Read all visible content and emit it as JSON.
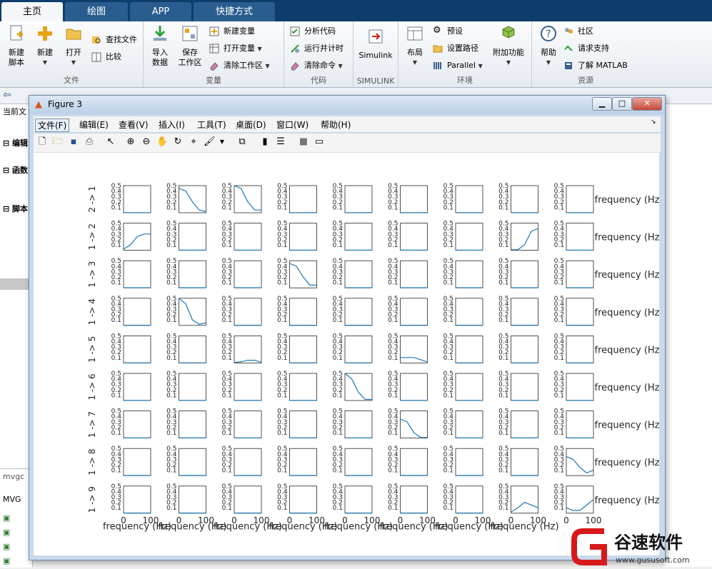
{
  "ribbon": {
    "tabs": [
      "主页",
      "绘图",
      "APP",
      "快捷方式"
    ],
    "groups": {
      "file": {
        "label": "文件",
        "new_script": "新建\n脚本",
        "new": "新建",
        "open": "打开",
        "find_files": "查找文件",
        "compare": "比较"
      },
      "variable": {
        "label": "变量",
        "import": "导入\n数据",
        "save_ws": "保存\n工作区",
        "new_var": "新建变量",
        "open_var": "打开变量",
        "clear_ws": "清除工作区"
      },
      "code": {
        "label": "代码",
        "analyze": "分析代码",
        "run_time": "运行并计时",
        "clear_cmd": "清除命令"
      },
      "simulink": {
        "label": "SIMULINK",
        "simulink": "Simulink"
      },
      "env": {
        "label": "环境",
        "layout": "布局",
        "prefs": "预设",
        "set_path": "设置路径",
        "parallel": "Parallel",
        "addons": "附加功能"
      },
      "resources": {
        "label": "资源",
        "help": "帮助",
        "community": "社区",
        "support": "请求支持",
        "learn": "了解 MATLAB"
      }
    }
  },
  "background": {
    "current_folder": "当前文",
    "editor": "编辑",
    "functions": "函数",
    "scripts": "脚本",
    "bottom_title": "mvgc",
    "bottom_item": "MVG"
  },
  "figure": {
    "title": "Figure 3",
    "menu": [
      "文件(F)",
      "编辑(E)",
      "查看(V)",
      "插入(I)",
      "工具(T)",
      "桌面(D)",
      "窗口(W)",
      "帮助(H)"
    ],
    "xlabel": "frequency (Hz)",
    "tick_x": [
      "0",
      "100"
    ],
    "tick_y": [
      "0.5",
      "0.4",
      "0.3",
      "0.2",
      "0.1"
    ]
  },
  "chart_data": {
    "type": "line",
    "title": "",
    "xlabel": "frequency (Hz)",
    "ylabel": "",
    "grid_size": [
      9,
      9
    ],
    "xlim": [
      0,
      100
    ],
    "ylim": [
      0,
      0.5
    ],
    "yticks": [
      0.1,
      0.2,
      0.3,
      0.4,
      0.5
    ],
    "xticks": [
      0,
      100
    ],
    "row_labels": [
      "2 -> 1",
      "1 -> 2",
      "1 -> 3",
      "1 -> 4",
      "1 -> 5",
      "1 -> 6",
      "1 -> 7",
      "1 -> 8",
      "1 -> 9"
    ],
    "subplots_with_signal": [
      {
        "row": 1,
        "col": 2,
        "series": [
          0.45,
          0.4,
          0.2,
          0.05,
          0.02
        ]
      },
      {
        "row": 1,
        "col": 3,
        "series": [
          0.5,
          0.45,
          0.2,
          0.05,
          0.05
        ]
      },
      {
        "row": 2,
        "col": 1,
        "series": [
          0.02,
          0.1,
          0.25,
          0.3,
          0.3
        ]
      },
      {
        "row": 2,
        "col": 8,
        "series": [
          0.01,
          0.01,
          0.1,
          0.35,
          0.4
        ]
      },
      {
        "row": 3,
        "col": 4,
        "series": [
          0.45,
          0.4,
          0.2,
          0.05,
          0.05
        ]
      },
      {
        "row": 4,
        "col": 2,
        "series": [
          0.5,
          0.4,
          0.1,
          0.02,
          0.05
        ]
      },
      {
        "row": 5,
        "col": 3,
        "series": [
          0.01,
          0.02,
          0.05,
          0.05,
          0.01
        ]
      },
      {
        "row": 5,
        "col": 6,
        "series": [
          0.1,
          0.1,
          0.1,
          0.06,
          0.02
        ]
      },
      {
        "row": 6,
        "col": 5,
        "series": [
          0.5,
          0.4,
          0.15,
          0.02,
          0.02
        ]
      },
      {
        "row": 7,
        "col": 6,
        "series": [
          0.35,
          0.3,
          0.1,
          0.01,
          0.01
        ]
      },
      {
        "row": 8,
        "col": 9,
        "series": [
          0.35,
          0.3,
          0.15,
          0.05,
          0.1
        ]
      },
      {
        "row": 9,
        "col": 8,
        "series": [
          0.02,
          0.1,
          0.2,
          0.15,
          0.1
        ]
      },
      {
        "row": 9,
        "col": 9,
        "series": [
          0.1,
          0.05,
          0.05,
          0.15,
          0.25
        ]
      }
    ]
  },
  "watermark": {
    "brand": "谷速软件",
    "url": "www.gususoft.com"
  },
  "colors": {
    "line": "#1f77b4",
    "axis": "#262626",
    "ribbon_dark": "#0d3d6b",
    "watermark_red": "#d7191c"
  }
}
